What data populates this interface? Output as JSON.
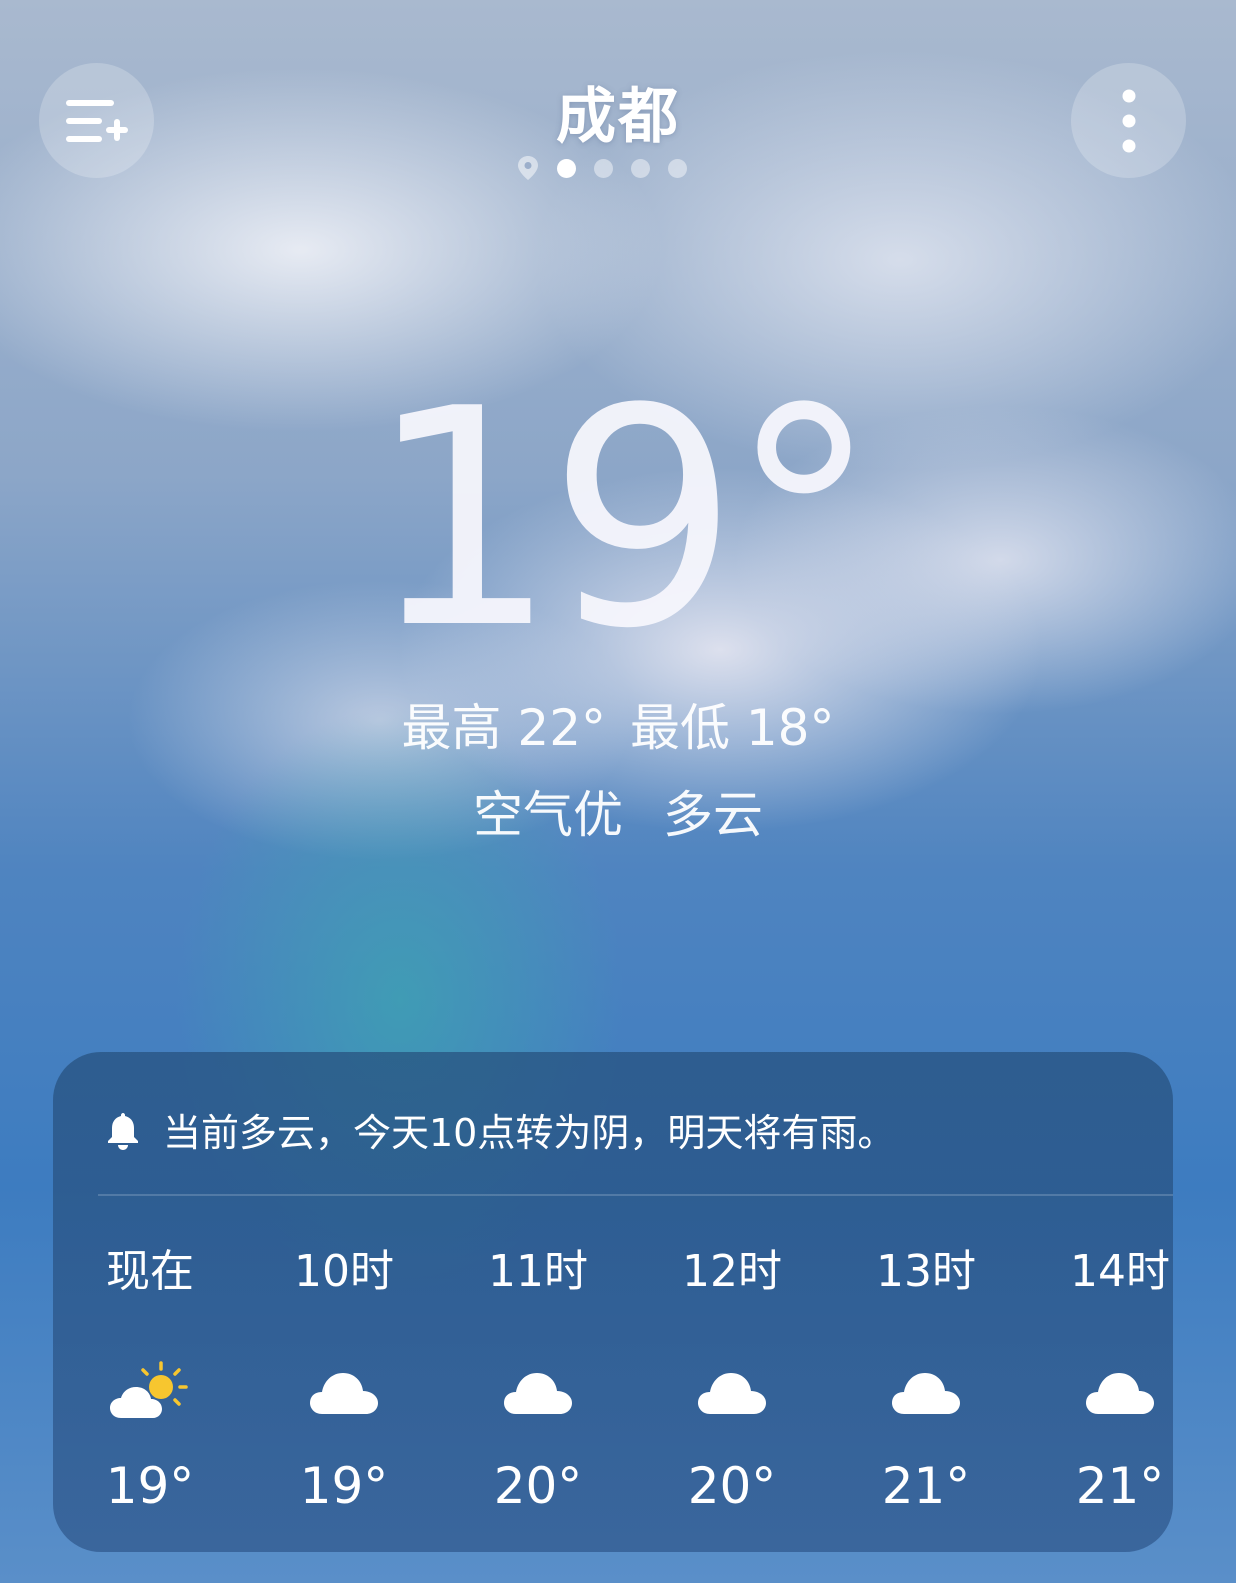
{
  "header": {
    "city": "成都",
    "menu_icon": "list-add-icon",
    "more_icon": "more-vertical-icon",
    "pager": {
      "location_icon": "location-pin-icon",
      "count": 4,
      "active": 0
    }
  },
  "current": {
    "temperature": "19°",
    "high_low": {
      "high": "最高 22°",
      "low": "最低 18°"
    },
    "air_quality": "空气优",
    "condition": "多云"
  },
  "forecast_card": {
    "alert_icon": "bell-icon",
    "alert_text": "当前多云，今天10点转为阴，明天将有雨。",
    "hours": [
      {
        "label": "现在",
        "icon": "partly-sunny-icon",
        "temp": "19°"
      },
      {
        "label": "10时",
        "icon": "cloud-icon",
        "temp": "19°"
      },
      {
        "label": "11时",
        "icon": "cloud-icon",
        "temp": "20°"
      },
      {
        "label": "12时",
        "icon": "cloud-icon",
        "temp": "20°"
      },
      {
        "label": "13时",
        "icon": "cloud-icon",
        "temp": "21°"
      },
      {
        "label": "14时",
        "icon": "cloud-icon",
        "temp": "21°"
      }
    ]
  },
  "colors": {
    "sun": "#f7c62f",
    "card_bg": "#2d5683"
  }
}
